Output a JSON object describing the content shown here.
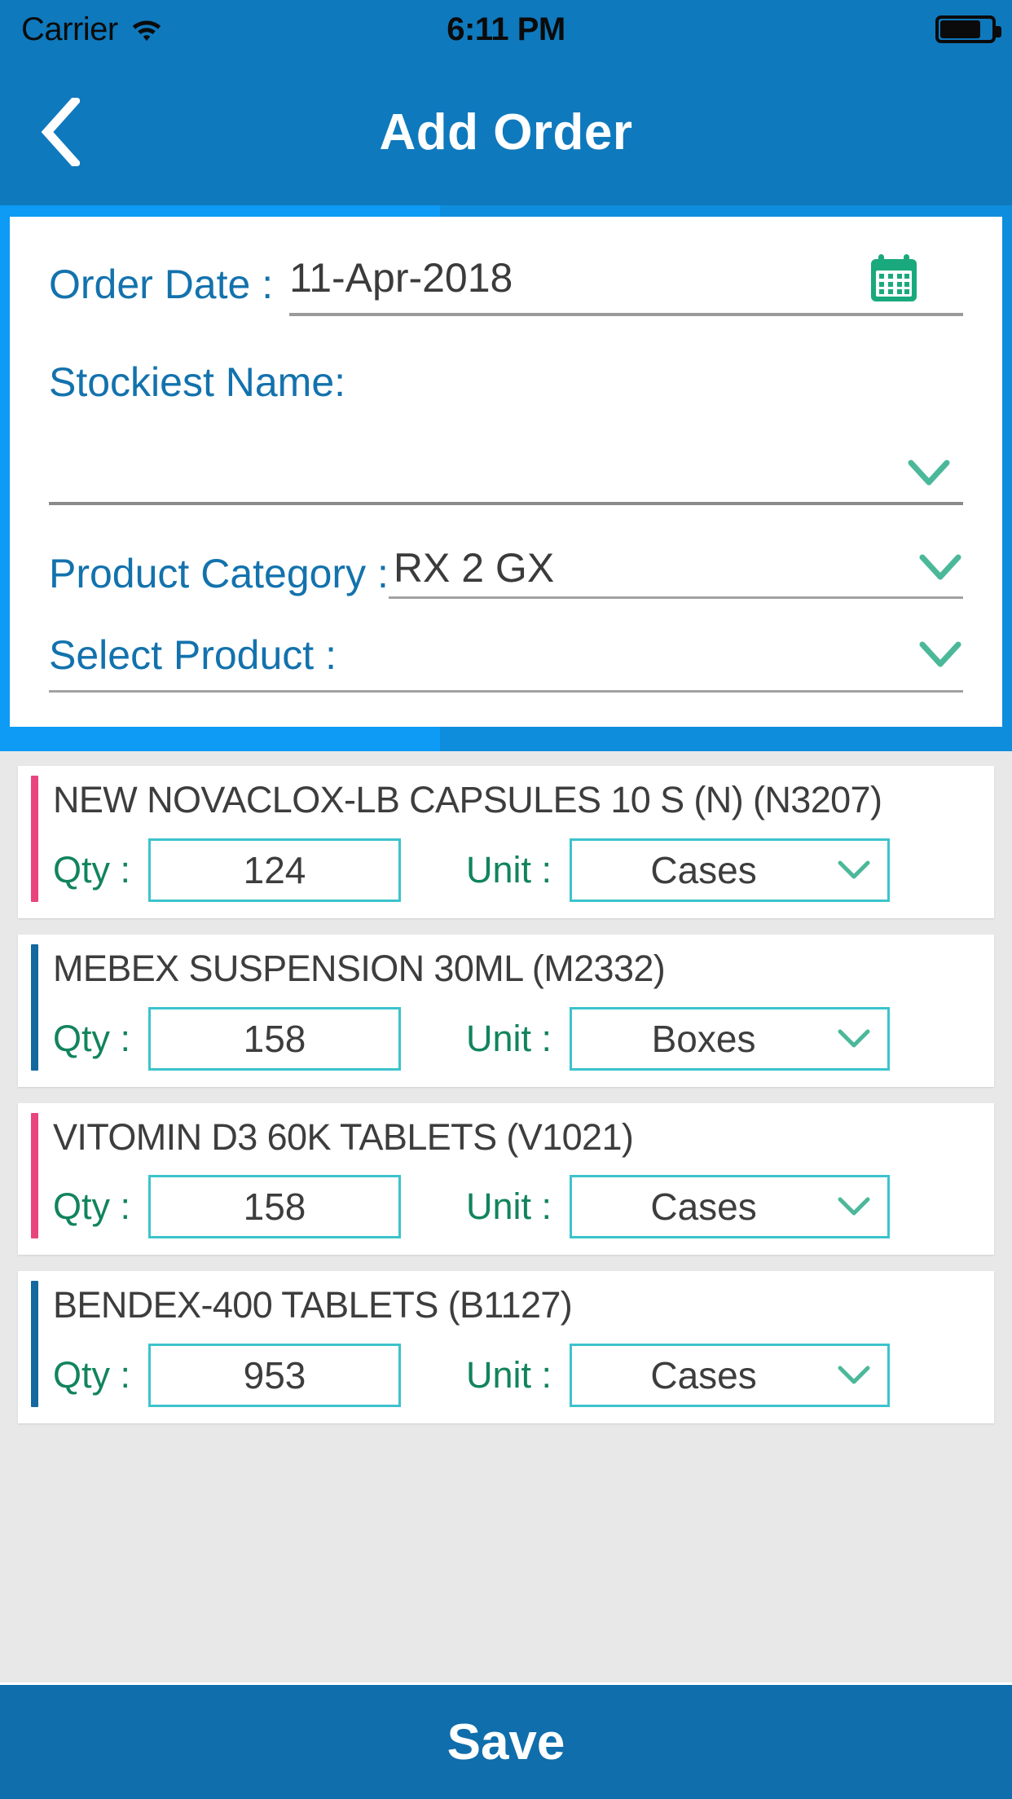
{
  "status_bar": {
    "carrier": "Carrier",
    "wifi_icon": "wifi-icon",
    "time": "6:11 PM",
    "battery_icon": "battery-icon"
  },
  "nav_bar": {
    "back_icon": "back-chevron-icon",
    "title": "Add Order"
  },
  "form": {
    "order_date": {
      "label": "Order Date :",
      "value": "11-Apr-2018",
      "icon": "calendar-icon"
    },
    "stockiest": {
      "label": "Stockiest Name:",
      "value": "",
      "icon": "chevron-down-icon"
    },
    "product_category": {
      "label": "Product Category :",
      "value": "RX 2 GX",
      "icon": "chevron-down-icon"
    },
    "select_product": {
      "label": "Select Product :",
      "value": "",
      "icon": "chevron-down-icon"
    }
  },
  "list_labels": {
    "qty": "Qty :",
    "unit": "Unit :"
  },
  "products": [
    {
      "name": "NEW NOVACLOX-LB CAPSULES 10 S (N) (N3207)",
      "qty": "124",
      "unit": "Cases",
      "accent": "#e8457f"
    },
    {
      "name": "MEBEX SUSPENSION 30ML (M2332)",
      "qty": "158",
      "unit": "Boxes",
      "accent": "#12689f"
    },
    {
      "name": "VITOMIN D3 60K TABLETS (V1021)",
      "qty": "158",
      "unit": "Cases",
      "accent": "#e8457f"
    },
    {
      "name": "BENDEX-400 TABLETS (B1127)",
      "qty": "953",
      "unit": "Cases",
      "accent": "#12689f"
    }
  ],
  "footer": {
    "save_label": "Save"
  },
  "colors": {
    "nav_blue": "#0f79bd",
    "panel_blue": "#0f8ddd",
    "panel_blue_light": "#0d9bf5",
    "label_blue": "#1372ad",
    "green": "#12845c",
    "teal_border": "#3cc3cc",
    "accent_pink": "#e8457f",
    "accent_navy": "#12689f",
    "save_blue": "#0f6eab",
    "list_bg": "#e8e8e8"
  }
}
